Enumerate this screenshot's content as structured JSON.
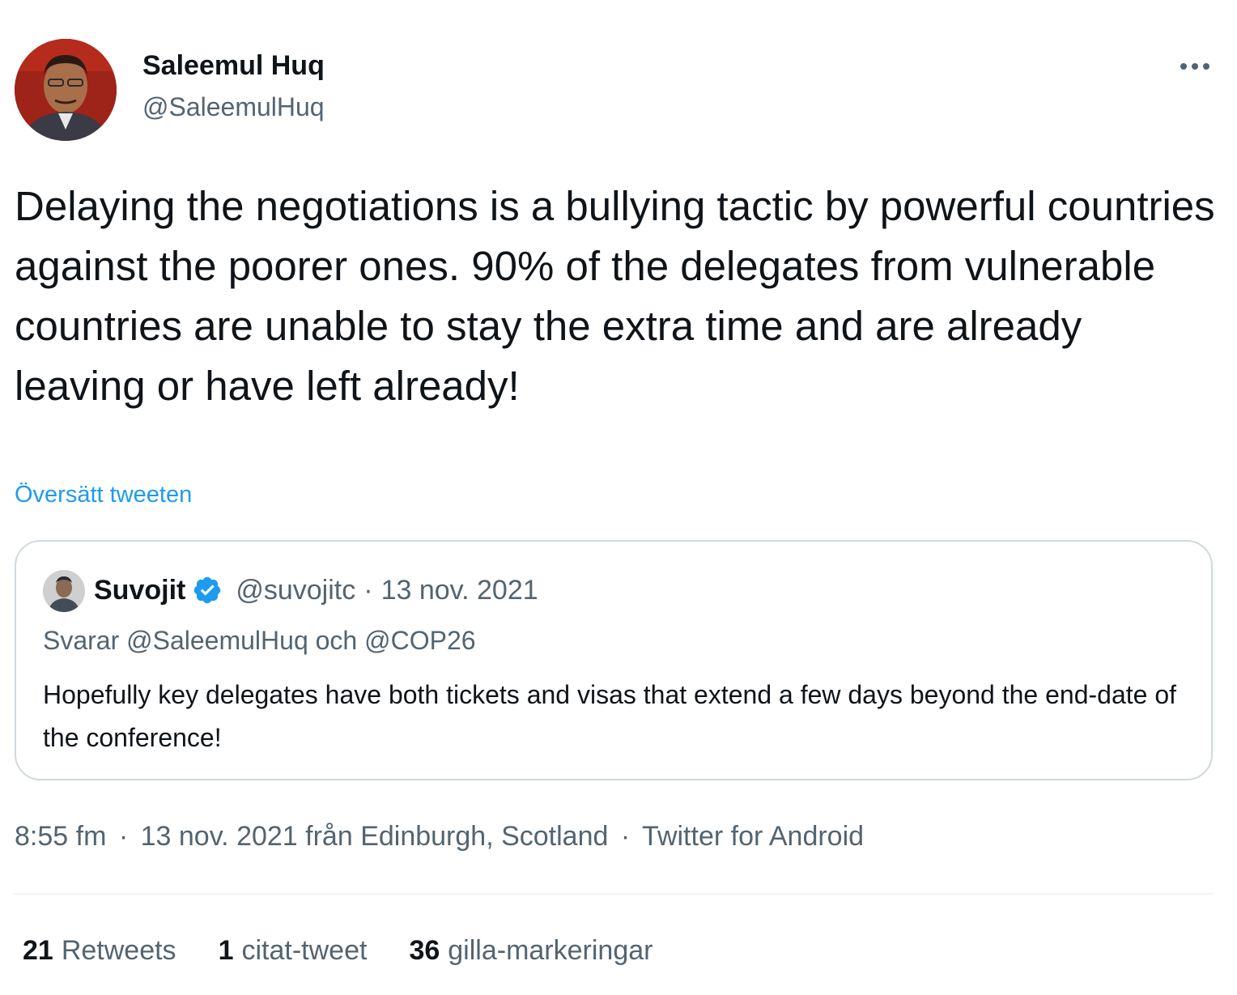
{
  "colors": {
    "accent": "#1d9bf0",
    "text_primary": "#0f1419",
    "text_secondary": "#536471",
    "border": "#cfd9de"
  },
  "tweet": {
    "author": {
      "name": "Saleemul Huq",
      "handle": "@SaleemulHuq",
      "avatar_icon": "profile-photo"
    },
    "more_icon": "ellipsis-icon",
    "text": "Delaying the negotiations is a bullying tactic by powerful countries against the poorer ones. 90% of the delegates from vulnerable countries are unable to stay the extra time and are already leaving or have left already!",
    "translate_label": "Översätt tweeten",
    "quote": {
      "name": "Suvojit",
      "verified_icon": "verified-badge-icon",
      "handle": "@suvojitc",
      "separator": "·",
      "date": "13 nov. 2021",
      "reply_to": "Svarar @SaleemulHuq och @COP26",
      "text": "Hopefully key delegates have both tickets and visas that extend a few days beyond the end-date of the conference!"
    },
    "meta": {
      "time": "8:55 fm",
      "separator": "·",
      "date_location": "13 nov. 2021 från Edinburgh, Scotland",
      "source": "Twitter for Android"
    },
    "stats": [
      {
        "count": "21",
        "label": "Retweets"
      },
      {
        "count": "1",
        "label": "citat-tweet"
      },
      {
        "count": "36",
        "label": "gilla-markeringar"
      }
    ]
  }
}
